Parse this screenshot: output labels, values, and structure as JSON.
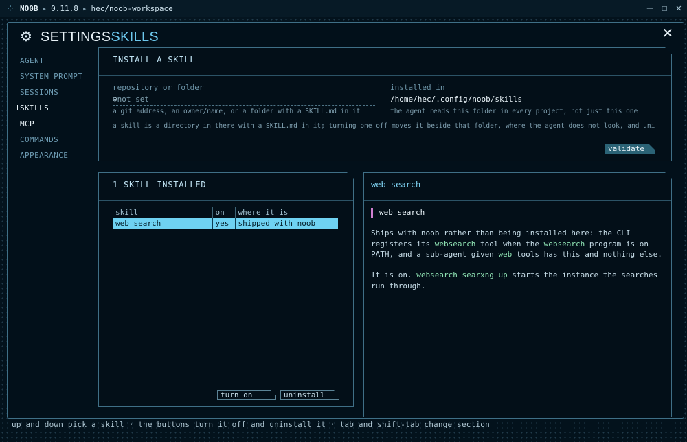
{
  "titlebar": {
    "app": "NO0B",
    "version": "0.11.8",
    "workspace": "hec/noob-workspace",
    "separator": "▸",
    "logo_icon": "noob-logo-icon",
    "minimize": "—",
    "maximize": "☐",
    "close": "✕"
  },
  "header": {
    "title": "SETTINGS",
    "section": "SKILLS",
    "close": "✕"
  },
  "sidebar": {
    "items": [
      {
        "label": "AGENT"
      },
      {
        "label": "SYSTEM PROMPT"
      },
      {
        "label": "SESSIONS"
      },
      {
        "label": "SKILLS"
      },
      {
        "label": "MCP"
      },
      {
        "label": "COMMANDS"
      },
      {
        "label": "APPEARANCE"
      }
    ],
    "active": "SKILLS"
  },
  "install": {
    "title": "INSTALL A SKILL",
    "repo_label": "repository or folder",
    "repo_placeholder": "not set",
    "repo_hint": "a git address, an owner/name, or a folder with a SKILL.md in it",
    "installed_label": "installed in",
    "installed_path": "/home/hec/.config/noob/skills",
    "installed_hint": "the agent reads this folder in every project, not just this one",
    "note": "a skill is a directory in there with a SKILL.md in it; turning one off moves it beside that folder, where the agent does not look, and unins…",
    "validate": "validate"
  },
  "skills": {
    "title": "1 SKILL INSTALLED",
    "columns": [
      "skill",
      "on",
      "where it is"
    ],
    "rows": [
      [
        "web search",
        "yes",
        "shipped with noob"
      ]
    ],
    "turn_on": "turn on",
    "uninstall": "uninstall"
  },
  "detail": {
    "title": "web search",
    "name": "web search",
    "p1": [
      [
        "Ships with noob rather than being installed here: the CLI",
        ""
      ],
      [
        "registers its ",
        "websearch",
        " tool when the ",
        "websearch",
        " program is on"
      ],
      [
        "PATH, and a sub-agent given ",
        "web",
        " tools has this and nothing else."
      ]
    ],
    "p2": [
      [
        "It is on. ",
        "websearch searxng up",
        " starts the instance the searches"
      ],
      [
        "run through."
      ]
    ]
  },
  "footer": "up and down pick a skill · the buttons turn it off and uninstall it · tab and shift-tab change section",
  "colors": {
    "accent": "#6cc7ec",
    "highlight": "#6fd2f2",
    "code": "#8fe3b4",
    "marker": "#d07fd0"
  }
}
